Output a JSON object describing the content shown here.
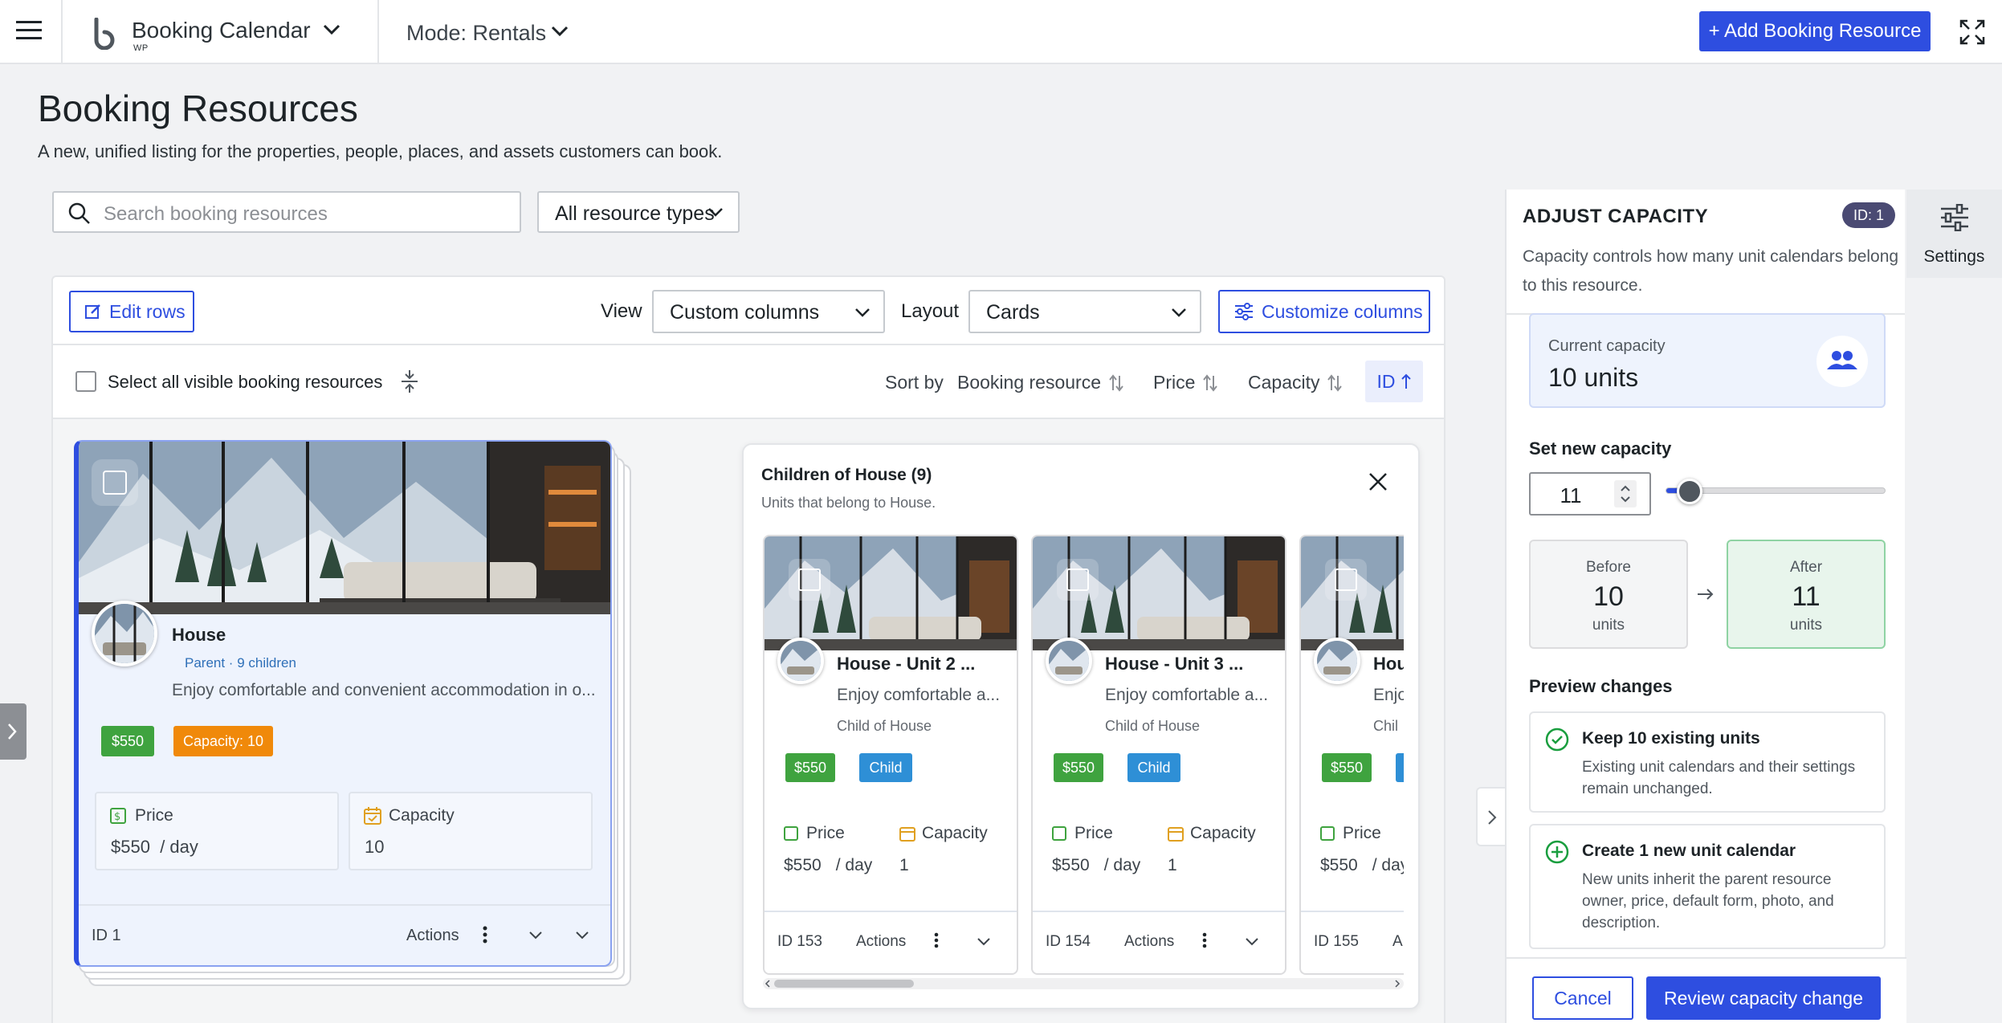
{
  "header": {
    "menu_icon": "hamburger-icon",
    "logo_icon": "booking-calendar-logo",
    "app_title": "Booking Calendar",
    "app_subtitle": "WP",
    "mode_label": "Mode: Rentals",
    "add_button_label": "+ Add Booking Resource",
    "fullscreen_icon": "expand-icon"
  },
  "page": {
    "title": "Booking Resources",
    "subtitle": "A new, unified listing for the properties, people, places, and assets customers can book."
  },
  "filters": {
    "search_placeholder": "Search booking resources",
    "resource_type_selected": "All resource types"
  },
  "toolbar": {
    "edit_rows_label": "Edit rows",
    "view_label": "View",
    "view_selected": "Custom columns",
    "layout_label": "Layout",
    "layout_selected": "Cards",
    "customize_label": "Customize columns"
  },
  "list_header": {
    "select_all_label": "Select all visible booking resources",
    "sort_by_label": "Sort by",
    "sort_options": [
      "Booking resource",
      "Price",
      "Capacity",
      "ID"
    ],
    "active_sort": "ID"
  },
  "main_card": {
    "title": "House",
    "meta": "Parent · 9 children",
    "description": "Enjoy comfortable and convenient accommodation in o...",
    "price_badge": "$550",
    "capacity_badge": "Capacity: 10",
    "price_label": "Price",
    "price_value": "$550",
    "price_unit": "/ day",
    "capacity_label": "Capacity",
    "capacity_value": "10",
    "id_label": "ID 1",
    "actions_label": "Actions"
  },
  "children_panel": {
    "title": "Children of House (9)",
    "subtitle": "Units that belong to House.",
    "cards": [
      {
        "title": "House - Unit 2 ...",
        "desc": "Enjoy comfortable a...",
        "sub": "Child of House",
        "price_badge": "$550",
        "type_badge": "Child",
        "price_label": "Price",
        "price_value": "$550",
        "price_unit": "/ day",
        "capacity_label": "Capacity",
        "capacity_value": "1",
        "id": "ID 153",
        "actions": "Actions"
      },
      {
        "title": "House - Unit 3 ...",
        "desc": "Enjoy comfortable a...",
        "sub": "Child of House",
        "price_badge": "$550",
        "type_badge": "Child",
        "price_label": "Price",
        "price_value": "$550",
        "price_unit": "/ day",
        "capacity_label": "Capacity",
        "capacity_value": "1",
        "id": "ID 154",
        "actions": "Actions"
      },
      {
        "title": "Hou",
        "desc": "Enjo",
        "sub": "Chil",
        "price_badge": "$550",
        "type_badge": "",
        "price_label": "Price",
        "price_value": "$550",
        "price_unit": "/ day",
        "capacity_label": "",
        "capacity_value": "",
        "id": "ID 155",
        "actions": "A"
      }
    ]
  },
  "side_panel": {
    "title": "ADJUST CAPACITY",
    "id_pill": "ID: 1",
    "description": "Capacity controls how many unit calendars belong to this resource.",
    "current_label": "Current capacity",
    "current_value": "10 units",
    "set_label": "Set new capacity",
    "new_value": "11",
    "slider_fraction": 0.06,
    "before_label": "Before",
    "before_value": "10",
    "before_unit": "units",
    "after_label": "After",
    "after_value": "11",
    "after_unit": "units",
    "preview_title": "Preview changes",
    "keep_title": "Keep 10 existing units",
    "keep_text": "Existing unit calendars and their settings remain unchanged.",
    "create_title": "Create 1 new unit calendar",
    "create_text": "New units inherit the parent resource owner, price, default form, photo, and description.",
    "cancel_label": "Cancel",
    "review_label": "Review capacity change"
  },
  "settings_tab": {
    "label": "Settings",
    "icon": "sliders-icon"
  },
  "colors": {
    "primary": "#2e4ee0",
    "price_badge": "#3fa33f",
    "capacity_badge": "#f0890a",
    "child_badge": "#2e8fd6",
    "success": "#1a9e3f"
  }
}
